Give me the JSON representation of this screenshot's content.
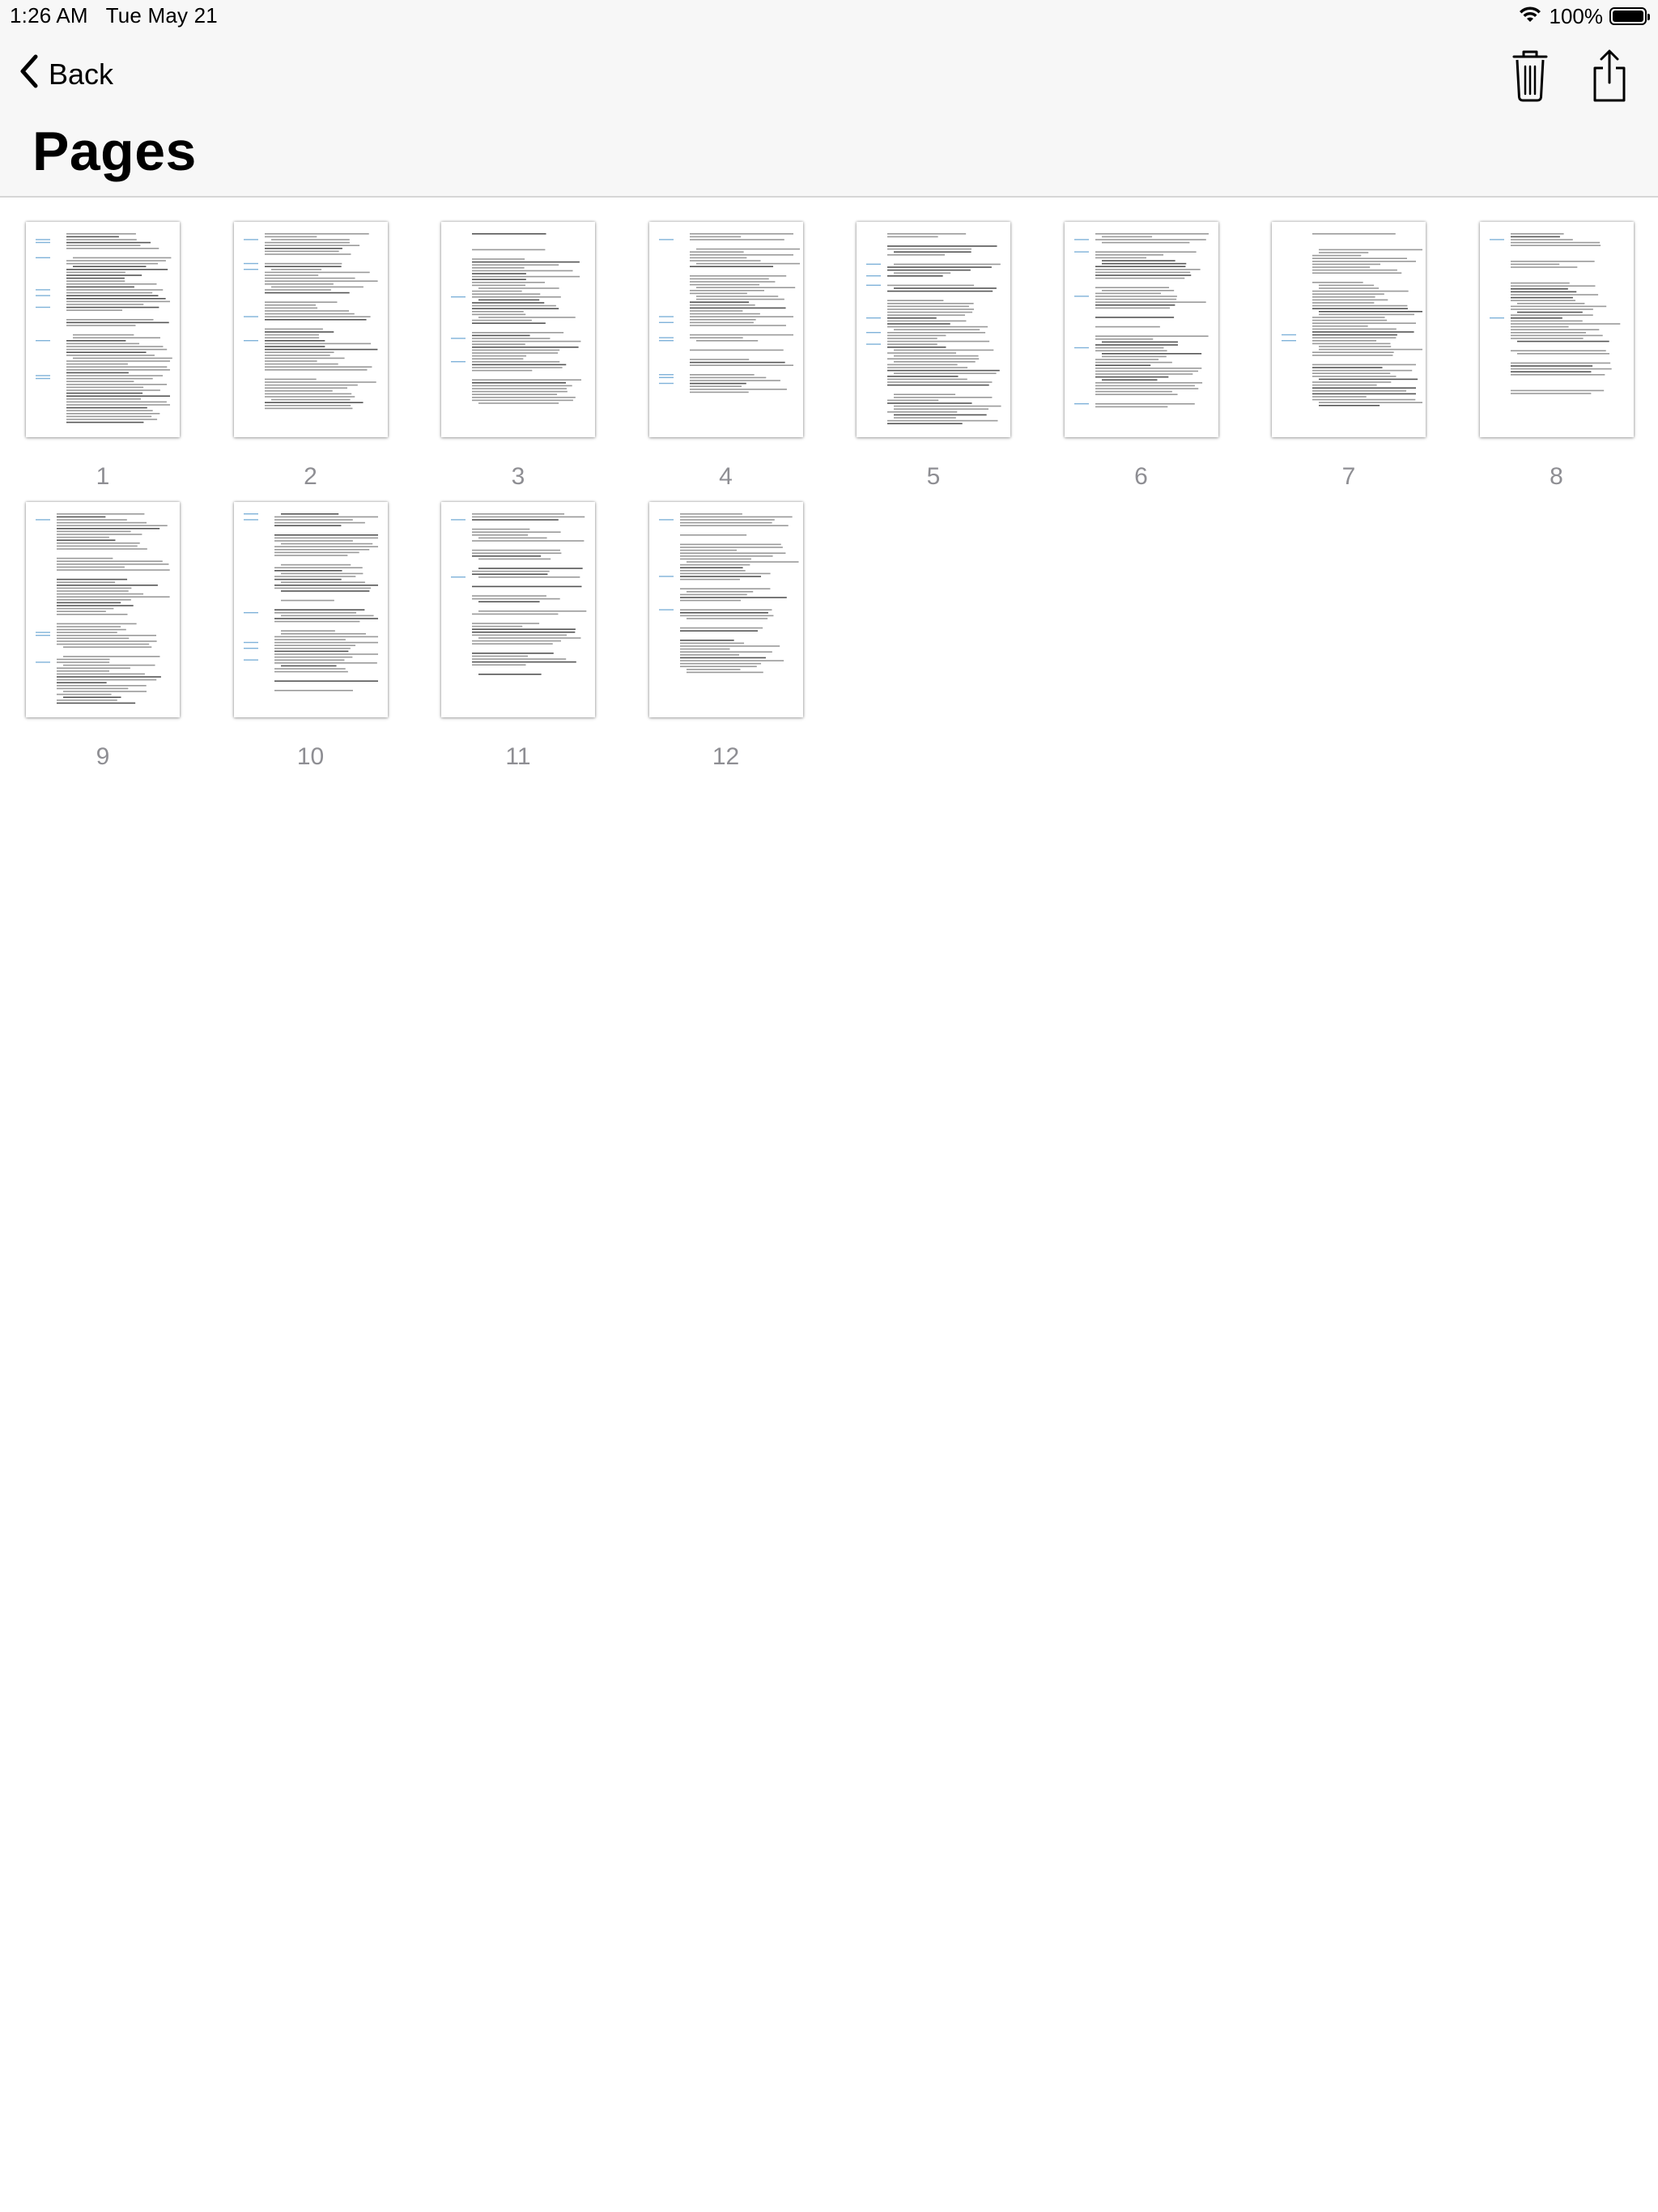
{
  "status_bar": {
    "time": "1:26 AM",
    "date": "Tue May 21",
    "battery_percent": "100%",
    "wifi_icon": "wifi-icon",
    "battery_icon": "battery-icon"
  },
  "nav": {
    "back_label": "Back",
    "title": "Pages",
    "actions": [
      "trash-icon",
      "share-icon"
    ]
  },
  "pages": [
    {
      "label": "1"
    },
    {
      "label": "2"
    },
    {
      "label": "3"
    },
    {
      "label": "4"
    },
    {
      "label": "5"
    },
    {
      "label": "6"
    },
    {
      "label": "7"
    },
    {
      "label": "8"
    },
    {
      "label": "9"
    },
    {
      "label": "10"
    },
    {
      "label": "11"
    },
    {
      "label": "12"
    }
  ]
}
